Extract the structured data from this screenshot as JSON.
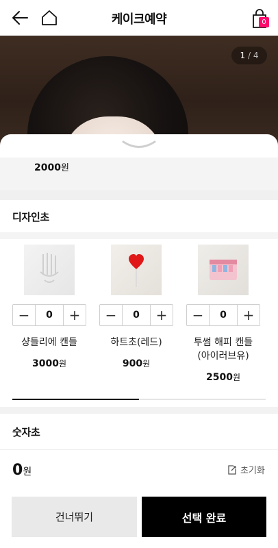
{
  "header": {
    "title": "케이크예약",
    "cart_count": "0",
    "icons": [
      "arrow-left-icon",
      "home-icon",
      "shopping-bag-icon"
    ]
  },
  "hero": {
    "counter_current": "1",
    "counter_sep": " / ",
    "counter_total": "4"
  },
  "previous_section": {
    "price": "2000",
    "currency": "원"
  },
  "design_candles": {
    "title": "디자인초",
    "items": [
      {
        "name": "샹들리에 캔들",
        "price": "3000",
        "currency": "원",
        "qty": "0",
        "thumb_icon": "chandelier-candle-image"
      },
      {
        "name": "하트초(레드)",
        "price": "900",
        "currency": "원",
        "qty": "0",
        "thumb_icon": "red-heart-candle-image"
      },
      {
        "name": "투썸 해피 캔들\n(아이러브유)",
        "name_line1": "투썸 해피 캔들",
        "name_line2": "(아이러브유)",
        "price": "2500",
        "currency": "원",
        "qty": "0",
        "thumb_icon": "happy-candle-box-image"
      }
    ],
    "scroll_progress": 0.5
  },
  "number_candles": {
    "title": "숫자초"
  },
  "summary": {
    "total": "0",
    "currency": "원",
    "reset_label": "초기화"
  },
  "buttons": {
    "skip_label": "건너뛰기",
    "done_label": "선택 완료"
  },
  "colors": {
    "accent": "#ff0a6c",
    "primary_button": "#000000",
    "secondary_button": "#e9e9e9"
  }
}
